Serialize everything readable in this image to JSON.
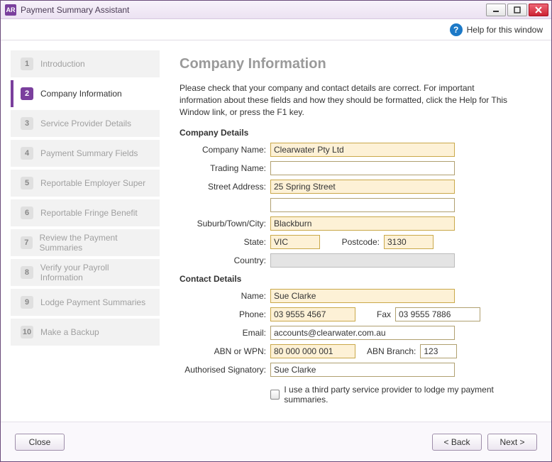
{
  "window": {
    "app_badge": "AR",
    "title": "Payment Summary Assistant"
  },
  "help": {
    "label": "Help for this window"
  },
  "steps": [
    {
      "num": "1",
      "label": "Introduction"
    },
    {
      "num": "2",
      "label": "Company Information"
    },
    {
      "num": "3",
      "label": "Service Provider Details"
    },
    {
      "num": "4",
      "label": "Payment Summary Fields"
    },
    {
      "num": "5",
      "label": "Reportable Employer Super"
    },
    {
      "num": "6",
      "label": "Reportable Fringe Benefit"
    },
    {
      "num": "7",
      "label": "Review the Payment Summaries"
    },
    {
      "num": "8",
      "label": "Verify your Payroll Information"
    },
    {
      "num": "9",
      "label": "Lodge Payment Summaries"
    },
    {
      "num": "10",
      "label": "Make a Backup"
    }
  ],
  "active_step_index": 1,
  "page": {
    "heading": "Company Information",
    "description": "Please check that your company and contact details are correct. For important information about these fields and how they should be formatted, click the Help for This Window link, or press the F1 key."
  },
  "company_details": {
    "section_label": "Company Details",
    "labels": {
      "company_name": "Company Name:",
      "trading_name": "Trading Name:",
      "street_address": "Street Address:",
      "suburb": "Suburb/Town/City:",
      "state": "State:",
      "postcode": "Postcode:",
      "country": "Country:"
    },
    "values": {
      "company_name": "Clearwater Pty Ltd",
      "trading_name": "",
      "street_address": "25 Spring Street",
      "street_address_2": "",
      "suburb": "Blackburn",
      "state": "VIC",
      "postcode": "3130",
      "country": ""
    }
  },
  "contact_details": {
    "section_label": "Contact Details",
    "labels": {
      "name": "Name:",
      "phone": "Phone:",
      "fax": "Fax",
      "email": "Email:",
      "abn": "ABN or WPN:",
      "abn_branch": "ABN Branch:",
      "signatory": "Authorised Signatory:"
    },
    "values": {
      "name": "Sue Clarke",
      "phone": "03 9555 4567",
      "fax": "03 9555 7886",
      "email": "accounts@clearwater.com.au",
      "abn": "80 000 000 001",
      "abn_branch": "123",
      "signatory": "Sue Clarke"
    }
  },
  "third_party": {
    "label": "I use a third party service provider to lodge my payment summaries.",
    "checked": false
  },
  "buttons": {
    "close": "Close",
    "back": "< Back",
    "next": "Next >"
  }
}
